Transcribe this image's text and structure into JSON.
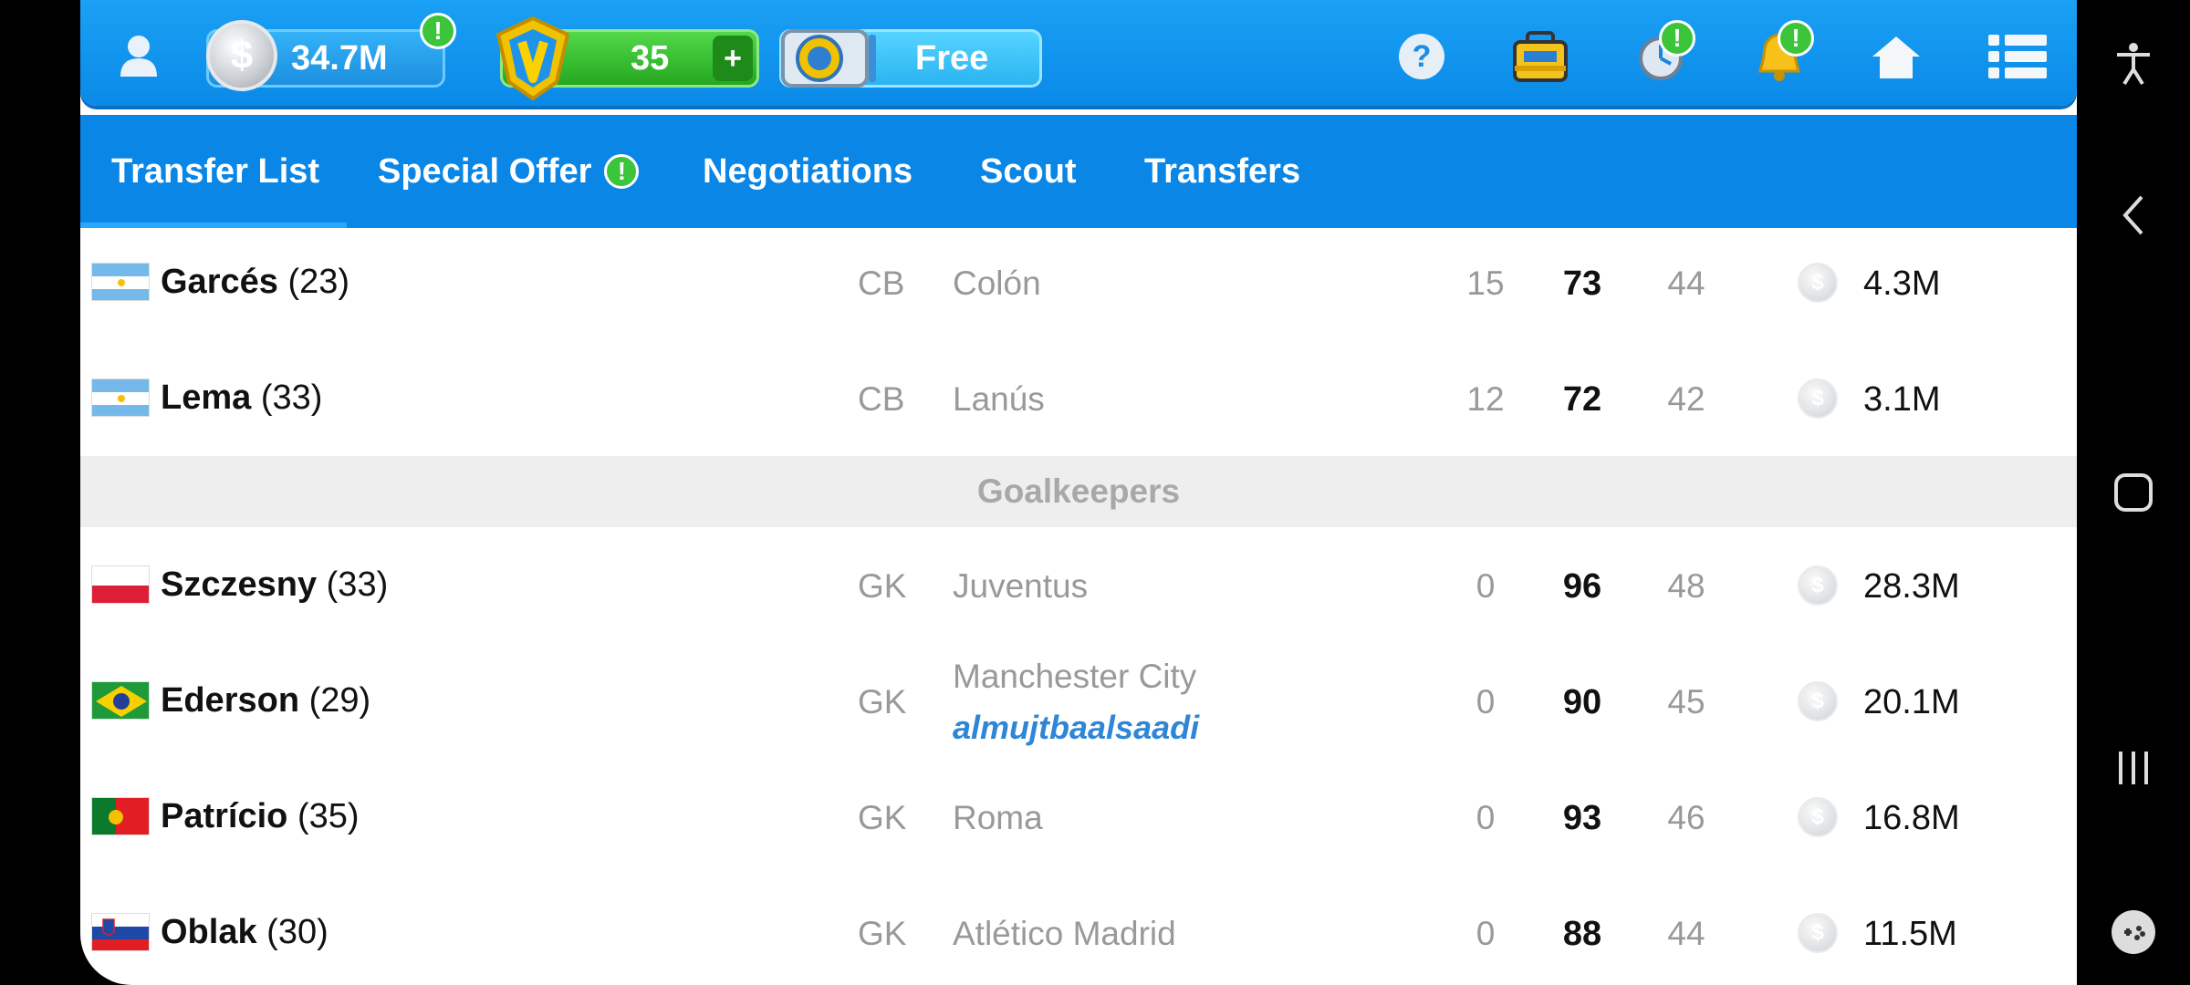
{
  "topbar": {
    "money": "34.7M",
    "tokens": "35",
    "tokens_add": "+",
    "boost": "Free",
    "badge_mark": "!"
  },
  "tabs": [
    {
      "label": "Transfer List",
      "active": true
    },
    {
      "label": "Special Offer",
      "badge": "!"
    },
    {
      "label": "Negotiations"
    },
    {
      "label": "Scout"
    },
    {
      "label": "Transfers"
    }
  ],
  "section_goalkeepers": "Goalkeepers",
  "players": [
    {
      "name": "Garcés",
      "age": "(23)",
      "flag": "argentina",
      "pos": "CB",
      "club": "Colón",
      "c1": "15",
      "c2": "73",
      "c3": "44",
      "price": "4.3M"
    },
    {
      "name": "Lema",
      "age": "(33)",
      "flag": "argentina",
      "pos": "CB",
      "club": "Lanús",
      "c1": "12",
      "c2": "72",
      "c3": "42",
      "price": "3.1M"
    },
    {
      "name": "Szczesny",
      "age": "(33)",
      "flag": "poland",
      "pos": "GK",
      "club": "Juventus",
      "c1": "0",
      "c2": "96",
      "c3": "48",
      "price": "28.3M"
    },
    {
      "name": "Ederson",
      "age": "(29)",
      "flag": "brazil",
      "pos": "GK",
      "club": "Manchester City",
      "owner": "almujtbaalsaadi",
      "c1": "0",
      "c2": "90",
      "c3": "45",
      "price": "20.1M"
    },
    {
      "name": "Patrício",
      "age": "(35)",
      "flag": "portugal",
      "pos": "GK",
      "club": "Roma",
      "c1": "0",
      "c2": "93",
      "c3": "46",
      "price": "16.8M"
    },
    {
      "name": "Oblak",
      "age": "(30)",
      "flag": "slovenia",
      "pos": "GK",
      "club": "Atlético Madrid",
      "c1": "0",
      "c2": "88",
      "c3": "44",
      "price": "11.5M"
    }
  ],
  "colors": {
    "topbar": "#0a8ae8",
    "tabs": "#0a86e6",
    "green": "#3cc43a",
    "owner_link": "#2f86d6"
  }
}
